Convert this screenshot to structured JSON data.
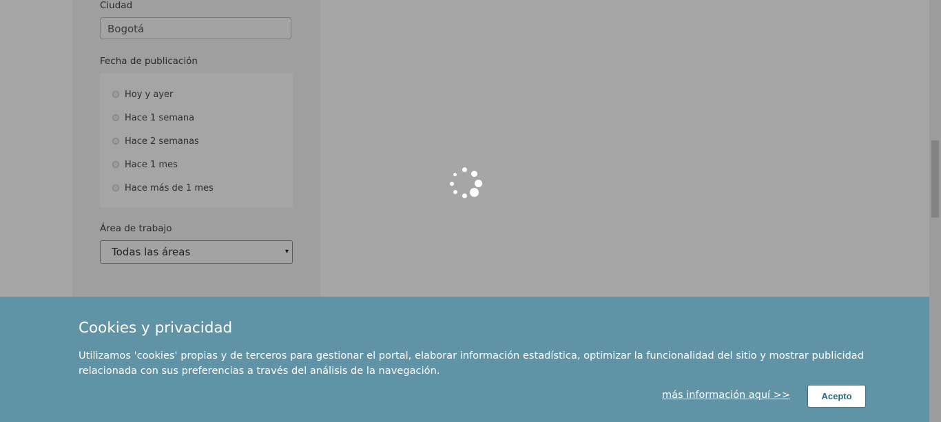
{
  "filters": {
    "city": {
      "label": "Ciudad",
      "value": "Bogotá"
    },
    "date": {
      "label": "Fecha de publicación",
      "options": [
        "Hoy y ayer",
        "Hace 1 semana",
        "Hace 2 semanas",
        "Hace 1 mes",
        "Hace más de 1 mes"
      ]
    },
    "area": {
      "label": "Área de trabajo",
      "selected": "Todas las áreas",
      "caret": "▾"
    }
  },
  "loading": {
    "icon": "loading-spinner-icon"
  },
  "cookie_banner": {
    "title": "Cookies y privacidad",
    "text": "Utilizamos 'cookies' propias y de terceros para gestionar el portal, elaborar información estadística, optimizar la funcionalidad del sitio y mostrar publicidad relacionada con sus preferencias a través del análisis de la navegación.",
    "more_link": "más información aquí >>",
    "accept": "Acepto"
  },
  "colors": {
    "banner": "#5f93a5",
    "overlay": "#a6a6a6",
    "accept_text": "#2a6a84"
  }
}
